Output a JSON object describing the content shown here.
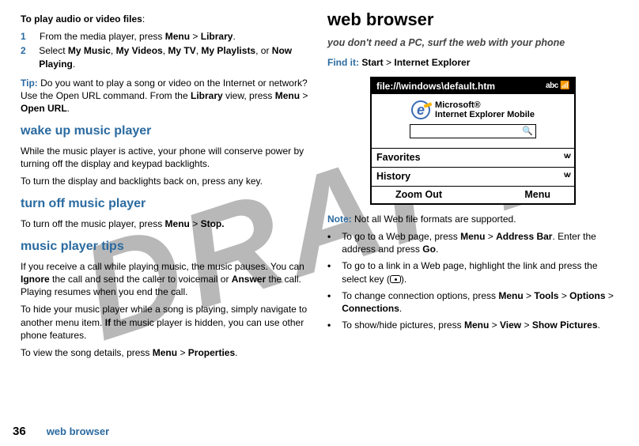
{
  "watermark": "DRAFT",
  "left": {
    "play_heading": "To play audio or video files",
    "steps": [
      {
        "n": "1",
        "pre": "From the media player, press ",
        "b1": "Menu",
        "mid": " > ",
        "b2": "Library",
        "post": "."
      },
      {
        "n": "2",
        "pre": "Select ",
        "b1": "My Music",
        "c1": ", ",
        "b2": "My Videos",
        "c2": ", ",
        "b3": "My TV",
        "c3": ", ",
        "b4": "My Playlists",
        "c4": ", or ",
        "b5": "Now Playing",
        "post": "."
      }
    ],
    "tip_label": "Tip:",
    "tip_text_a": " Do you want to play a song or video on the Internet or network? Use the Open URL command. From the ",
    "tip_b1": "Library",
    "tip_text_b": " view, press ",
    "tip_b2": "Menu",
    "tip_gt": " > ",
    "tip_b3": "Open URL",
    "tip_post": ".",
    "wake_h": "wake up music player",
    "wake_p1": "While the music player is active, your phone will conserve power by turning off the display and keypad backlights.",
    "wake_p2": "To turn the display and backlights back on, press any key.",
    "off_h": "turn off music player",
    "off_p_a": "To turn off the music player, press ",
    "off_b1": "Menu",
    "off_gt": " > ",
    "off_b2": "Stop.",
    "tips_h": "music player tips",
    "tips_p1_a": "If you receive a call while playing music, the music pauses. You can ",
    "tips_b1": "Ignore",
    "tips_p1_b": " the call and send the caller to voicemail or ",
    "tips_b2": "Answer",
    "tips_p1_c": " the call. Playing resumes when you end the call.",
    "tips_p2_a": "To hide your music player while a song is playing, simply navigate to another menu item.",
    "tips_p2_bold": "If",
    "tips_p2_b": " the music player is hidden, you can use other phone features.",
    "tips_p3_a": "To view the song details, press ",
    "tips_p3_b1": "Menu",
    "tips_p3_gt": " > ",
    "tips_p3_b2": "Properties",
    "tips_p3_post": "."
  },
  "right": {
    "title": "web browser",
    "subtitle": "you don't need a PC, surf the web with your phone",
    "findit_label": "Find it:",
    "findit_b1": "Start",
    "findit_gt": " > ",
    "findit_b2": "Internet Explorer",
    "phone": {
      "titlebar": "file://\\windows\\default.htm",
      "indicator": "abc 📶",
      "logo_line1": "Microsoft®",
      "logo_line2": "Internet Explorer Mobile",
      "fav": "Favorites",
      "hist": "History",
      "soft_left": "Zoom Out",
      "soft_right": "Menu"
    },
    "note_label": "Note:",
    "note_text": " Not all Web file formats are supported.",
    "bullets": [
      {
        "a": "To go to a Web page, press ",
        "b1": "Menu",
        "g1": " > ",
        "b2": "Address Bar",
        "a2": ". Enter the address and press ",
        "b3": "Go",
        "post": "."
      },
      {
        "a": "To go to a link in a Web page, highlight the link and press the select key (",
        "key": true,
        "post": ")."
      },
      {
        "a": "To change connection options, press ",
        "b1": "Menu",
        "g1": " > ",
        "b2": "Tools",
        "g2": " > ",
        "b3": "Options",
        "g3": " > ",
        "b4": "Connections",
        "post": "."
      },
      {
        "a": "To show/hide pictures, press ",
        "b1": "Menu",
        "g1": " > ",
        "b2": "View",
        "g2": " > ",
        "b3": "Show Pictures",
        "post": "."
      }
    ]
  },
  "footer": {
    "page": "36",
    "label": "web browser"
  }
}
